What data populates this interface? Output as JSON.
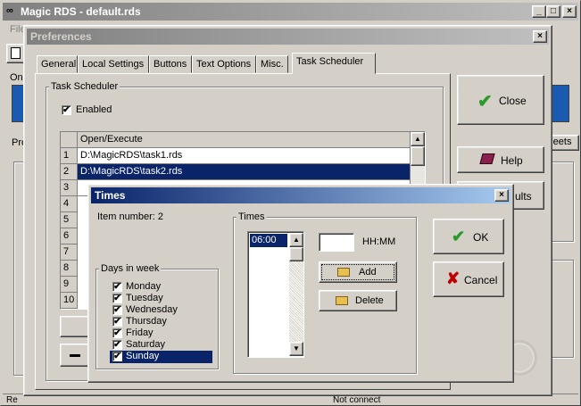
{
  "main_window": {
    "title": "Magic RDS - default.rds",
    "menu_partial": "File",
    "left_label_1": "On",
    "left_label_2": "Pro",
    "right_partial_button": "heets",
    "status_left": "Re",
    "status_right": "Not connect"
  },
  "prefs": {
    "title": "Preferences",
    "tabs": [
      "General",
      "Local Settings",
      "Buttons",
      "Text Options",
      "Misc.",
      "Task Scheduler"
    ],
    "active_tab": "Task Scheduler",
    "group_title": "Task Scheduler",
    "enabled_label": "Enabled",
    "enabled_checked": "✔",
    "grid_header": "Open/Execute",
    "rows": [
      {
        "num": "1",
        "value": "D:\\MagicRDS\\task1.rds"
      },
      {
        "num": "2",
        "value": "D:\\MagicRDS\\task2.rds"
      },
      {
        "num": "3",
        "value": ""
      },
      {
        "num": "4",
        "value": ""
      },
      {
        "num": "5",
        "value": ""
      },
      {
        "num": "6",
        "value": ""
      },
      {
        "num": "7",
        "value": ""
      },
      {
        "num": "8",
        "value": ""
      },
      {
        "num": "9",
        "value": ""
      },
      {
        "num": "10",
        "value": ""
      }
    ],
    "close_label": "Close",
    "help_label": "Help",
    "defaults_partial": "ults"
  },
  "times": {
    "title": "Times",
    "item_number_label": "Item number: 2",
    "days_group": "Days in week",
    "days": [
      "Monday",
      "Tuesday",
      "Wednesday",
      "Thursday",
      "Friday",
      "Saturday",
      "Sunday"
    ],
    "selected_day": "Sunday",
    "times_group": "Times",
    "times_list": [
      "06:00"
    ],
    "time_input_value": "",
    "time_format": "HH:MM",
    "add_label": "Add",
    "delete_label": "Delete",
    "ok_label": "OK",
    "cancel_label": "Cancel",
    "check": "✔"
  },
  "colors": {
    "face": "#d4d0c8",
    "title_active": "#0a246a",
    "selection": "#0a246a",
    "ok_green": "#2a9a2a",
    "cancel_red": "#c00000"
  }
}
